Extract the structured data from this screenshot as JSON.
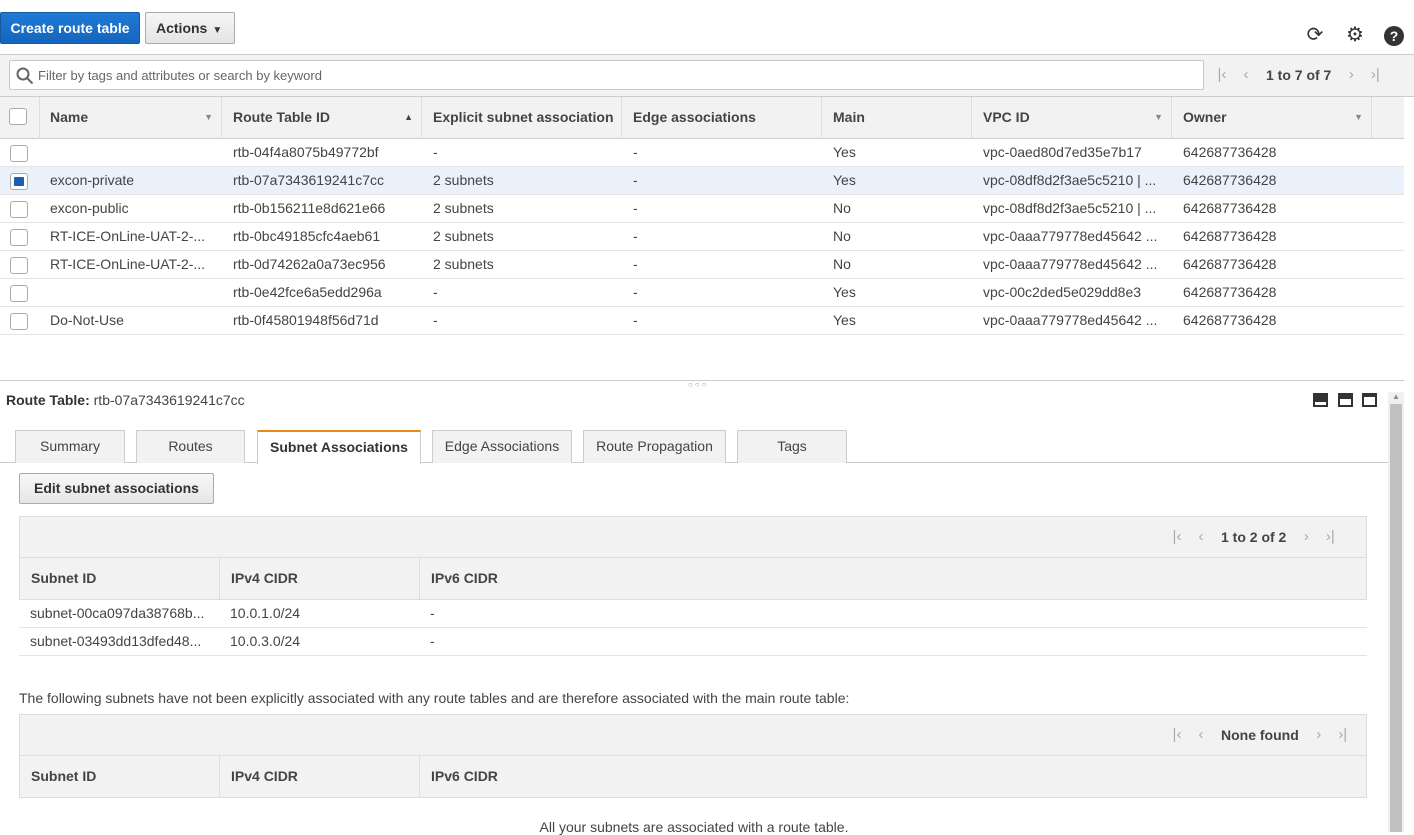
{
  "toolbar": {
    "create_label": "Create route table",
    "actions_label": "Actions"
  },
  "filter": {
    "placeholder": "Filter by tags and attributes or search by keyword",
    "pager_text": "1 to 7 of 7"
  },
  "table": {
    "columns": [
      "Name",
      "Route Table ID",
      "Explicit subnet association",
      "Edge associations",
      "Main",
      "VPC ID",
      "Owner"
    ],
    "rows": [
      {
        "name": "",
        "id": "rtb-04f4a8075b49772bf",
        "subnets": "-",
        "edge": "-",
        "main": "Yes",
        "vpc": "vpc-0aed80d7ed35e7b17",
        "owner": "642687736428",
        "selected": false
      },
      {
        "name": "excon-private",
        "id": "rtb-07a7343619241c7cc",
        "subnets": "2 subnets",
        "edge": "-",
        "main": "Yes",
        "vpc": "vpc-08df8d2f3ae5c5210 | ...",
        "owner": "642687736428",
        "selected": true
      },
      {
        "name": "excon-public",
        "id": "rtb-0b156211e8d621e66",
        "subnets": "2 subnets",
        "edge": "-",
        "main": "No",
        "vpc": "vpc-08df8d2f3ae5c5210 | ...",
        "owner": "642687736428",
        "selected": false
      },
      {
        "name": "RT-ICE-OnLine-UAT-2-...",
        "id": "rtb-0bc49185cfc4aeb61",
        "subnets": "2 subnets",
        "edge": "-",
        "main": "No",
        "vpc": "vpc-0aaa779778ed45642 ...",
        "owner": "642687736428",
        "selected": false
      },
      {
        "name": "RT-ICE-OnLine-UAT-2-...",
        "id": "rtb-0d74262a0a73ec956",
        "subnets": "2 subnets",
        "edge": "-",
        "main": "No",
        "vpc": "vpc-0aaa779778ed45642 ...",
        "owner": "642687736428",
        "selected": false
      },
      {
        "name": "",
        "id": "rtb-0e42fce6a5edd296a",
        "subnets": "-",
        "edge": "-",
        "main": "Yes",
        "vpc": "vpc-00c2ded5e029dd8e3",
        "owner": "642687736428",
        "selected": false
      },
      {
        "name": "Do-Not-Use",
        "id": "rtb-0f45801948f56d71d",
        "subnets": "-",
        "edge": "-",
        "main": "Yes",
        "vpc": "vpc-0aaa779778ed45642 ...",
        "owner": "642687736428",
        "selected": false
      }
    ]
  },
  "detail": {
    "title_label": "Route Table:",
    "title_value": "rtb-07a7343619241c7cc",
    "tabs": [
      "Summary",
      "Routes",
      "Subnet Associations",
      "Edge Associations",
      "Route Propagation",
      "Tags"
    ],
    "active_tab": "Subnet Associations",
    "edit_label": "Edit subnet associations",
    "explicit": {
      "pager_text": "1 to 2 of 2",
      "columns": [
        "Subnet ID",
        "IPv4 CIDR",
        "IPv6 CIDR"
      ],
      "rows": [
        {
          "subnet": "subnet-00ca097da38768b...",
          "ipv4": "10.0.1.0/24",
          "ipv6": "-"
        },
        {
          "subnet": "subnet-03493dd13dfed48...",
          "ipv4": "10.0.3.0/24",
          "ipv6": "-"
        }
      ]
    },
    "note": "The following subnets have not been explicitly associated with any route tables and are therefore associated with the main route table:",
    "implicit": {
      "pager_text": "None found",
      "columns": [
        "Subnet ID",
        "IPv4 CIDR",
        "IPv6 CIDR"
      ],
      "empty_text": "All your subnets are associated with a route table."
    }
  },
  "icons": {
    "refresh": "refresh-icon",
    "settings": "gear-icon",
    "help": "help-icon",
    "search": "search-icon"
  },
  "colors": {
    "primary_button": "#1a6fc9",
    "link": "#1a6ab0",
    "active_tab_accent": "#e88a1a",
    "selected_row": "#eaf1fb"
  }
}
